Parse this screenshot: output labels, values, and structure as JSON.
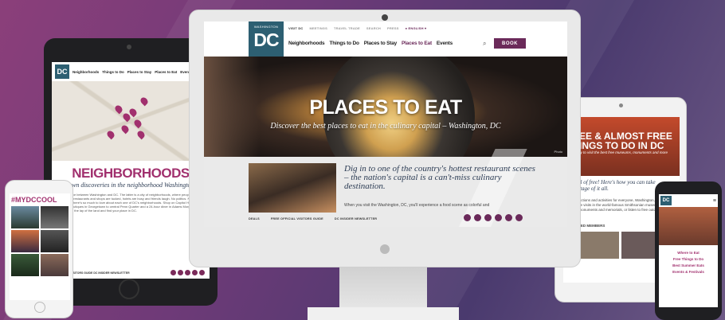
{
  "monitor": {
    "logo_small": "WASHINGTON",
    "logo_big": "DC",
    "top_nav": [
      "VISIT DC",
      "MEETINGS",
      "TRAVEL TRADE",
      "SEARCH",
      "PRESS"
    ],
    "language": "ENGLISH",
    "main_nav": [
      "Neighborhoods",
      "Things to Do",
      "Places to Stay",
      "Places to Eat",
      "Events"
    ],
    "active_nav": "Places to Eat",
    "book_label": "BOOK",
    "hero_title": "PLACES TO EAT",
    "hero_subtitle": "Discover the best places to eat in the culinary capital – Washington, DC",
    "hero_credit": "Photo",
    "intro_text": "Dig in to one of the country's hottest restaurant scenes – the nation's capital is a can't-miss culinary destination.",
    "intro_small": "When you visit the Washington, DC, you'll experience a food scene as colorful and",
    "footer_links": [
      "DEALS",
      "FREE OFFICIAL VISITORS GUIDE",
      "DC INSIDER NEWSLETTER"
    ]
  },
  "tablet_left": {
    "logo": "DC",
    "nav": [
      "Neighborhoods",
      "Things to Do",
      "Places to Stay",
      "Places to Eat",
      "Events"
    ],
    "title": "NEIGHBORHOODS",
    "subtitle": "your own discoveries in the neighborhood Washington, DC",
    "body": "the difference between Washington and DC. The latter is a city of neighborhoods, where people live and visit, where restaurants and shops are tucked, hotels are busy and friends laugh. No politics. No problems. There's so much to love about each one of DC's neighborhoods. Shop on Capitol Hill and high-end boutiques in Georgetown to central Penn Quarter and a 24-hour diner in Adams Morgan. Get familiar with the lay of the land and find your place in DC.",
    "footer_links": "OFFICIAL VISITORS GUIDE    DC INSIDER NEWSLETTER"
  },
  "phone_left": {
    "hashtag": "#MYDCCOOL"
  },
  "tablet_right": {
    "hero_title": "FREE & ALMOST FREE THINGS TO DO IN DC",
    "hero_sub": "Get ready to visit the best free museums, monuments and more",
    "heading": "capital of free! Here's how you can take advantage of it all.",
    "body": "with attractions and activities for everyone, Washington, DC offers many free visits in the world-famous Smithsonian museums, tour historic monuments and memorials, or listen to free outdoor concerts.",
    "section": "FEATURED MEMBERS"
  },
  "phone_right": {
    "logo": "DC",
    "menu": [
      "Where to Eat",
      "Free Things to Do",
      "Best Summer Eats",
      "Events & Festivals"
    ]
  }
}
